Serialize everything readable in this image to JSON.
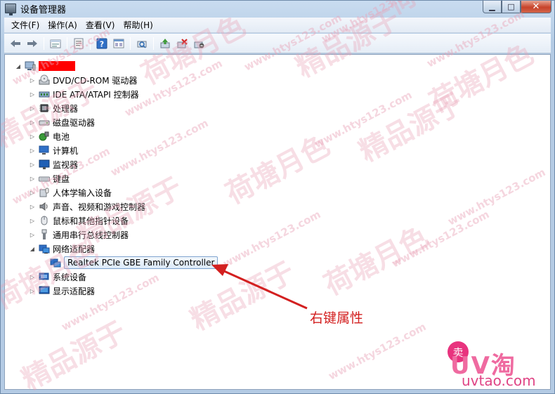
{
  "window": {
    "title": "设备管理器",
    "controls": {
      "minimize": "▁",
      "maximize": "□",
      "close": "✕"
    }
  },
  "menu": [
    {
      "label": "文件(F)"
    },
    {
      "label": "操作(A)"
    },
    {
      "label": "查看(V)"
    },
    {
      "label": "帮助(H)"
    }
  ],
  "toolbar": [
    {
      "icon": "back-arrow-icon"
    },
    {
      "icon": "forward-arrow-icon"
    },
    {
      "icon": "up-level-icon"
    },
    {
      "icon": "properties-icon"
    },
    {
      "icon": "help-icon"
    },
    {
      "icon": "view-icon"
    },
    {
      "icon": "scan-hardware-icon"
    },
    {
      "icon": "update-driver-icon"
    },
    {
      "icon": "disable-device-icon"
    },
    {
      "icon": "uninstall-icon"
    }
  ],
  "tree": {
    "root_redacted": true,
    "categories": [
      {
        "label": "DVD/CD-ROM 驱动器",
        "icon": "dvd-icon",
        "expanded": false
      },
      {
        "label": "IDE ATA/ATAPI 控制器",
        "icon": "ide-controller-icon",
        "expanded": false
      },
      {
        "label": "处理器",
        "icon": "processor-icon",
        "expanded": false
      },
      {
        "label": "磁盘驱动器",
        "icon": "disk-drive-icon",
        "expanded": false
      },
      {
        "label": "电池",
        "icon": "battery-icon",
        "expanded": false
      },
      {
        "label": "计算机",
        "icon": "computer-icon",
        "expanded": false
      },
      {
        "label": "监视器",
        "icon": "monitor-icon",
        "expanded": false
      },
      {
        "label": "键盘",
        "icon": "keyboard-icon",
        "expanded": false
      },
      {
        "label": "人体学输入设备",
        "icon": "hid-icon",
        "expanded": false
      },
      {
        "label": "声音、视频和游戏控制器",
        "icon": "sound-icon",
        "expanded": false
      },
      {
        "label": "鼠标和其他指针设备",
        "icon": "mouse-icon",
        "expanded": false
      },
      {
        "label": "通用串行总线控制器",
        "icon": "usb-icon",
        "expanded": false
      },
      {
        "label": "网络适配器",
        "icon": "network-adapter-icon",
        "expanded": true,
        "children": [
          {
            "label": "Realtek PCIe GBE Family Controller",
            "icon": "network-card-icon"
          }
        ]
      },
      {
        "label": "系统设备",
        "icon": "system-device-icon",
        "expanded": false
      },
      {
        "label": "显示适配器",
        "icon": "display-adapter-icon",
        "expanded": false
      }
    ]
  },
  "annotation": {
    "text": "右键属性",
    "color": "#d32020"
  },
  "watermark": {
    "chinese": [
      "精品源于",
      "荷塘月色"
    ],
    "url": "www.htys123.com",
    "logo_text": "UV淘",
    "logo_badge": "卖",
    "logo_url": "uvtao.com"
  },
  "colors": {
    "accent": "#d32020",
    "selection_border": "#7da2ce",
    "redaction": "#ff0000"
  }
}
